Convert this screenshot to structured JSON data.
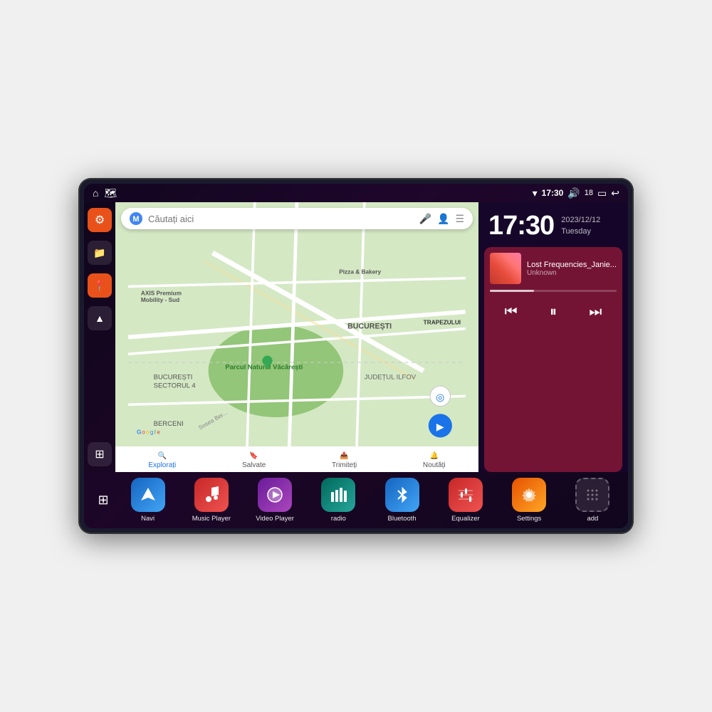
{
  "device": {
    "title": "Car Android Head Unit"
  },
  "statusBar": {
    "wifi_icon": "▾",
    "time": "17:30",
    "volume_icon": "🔊",
    "battery_level": "18",
    "battery_icon": "🔋",
    "back_icon": "↩"
  },
  "sidebar": {
    "icons": [
      {
        "name": "settings",
        "symbol": "⚙",
        "style": "orange"
      },
      {
        "name": "files",
        "symbol": "📁",
        "style": "dark"
      },
      {
        "name": "maps",
        "symbol": "📍",
        "style": "orange"
      },
      {
        "name": "navigation",
        "symbol": "▲",
        "style": "dark"
      }
    ]
  },
  "map": {
    "searchPlaceholder": "Căutați aici",
    "bottomItems": [
      {
        "label": "Explorați",
        "icon": "🔍",
        "active": true
      },
      {
        "label": "Salvate",
        "icon": "🔖",
        "active": false
      },
      {
        "label": "Trimiteți",
        "icon": "📤",
        "active": false
      },
      {
        "label": "Noutăți",
        "icon": "🔔",
        "active": false
      }
    ],
    "labels": [
      "AXIS Premium Mobility - Sud",
      "Pizza & Bakery",
      "Parcul Natural Văcărești",
      "BUCUREȘTI",
      "SECTORUL 4",
      "BUCUREȘTI",
      "JUDEȚUL ILFOV",
      "BERCENI",
      "TRAPEZULUI"
    ]
  },
  "clock": {
    "time": "17:30",
    "date": "2023/12/12",
    "day": "Tuesday"
  },
  "musicPlayer": {
    "songTitle": "Lost Frequencies_Janie...",
    "artist": "Unknown",
    "prevIcon": "⏮",
    "pauseIcon": "⏸",
    "nextIcon": "⏭"
  },
  "apps": [
    {
      "id": "navi",
      "label": "Navi",
      "style": "blue-nav",
      "icon": "▲"
    },
    {
      "id": "music-player",
      "label": "Music Player",
      "style": "red-music",
      "icon": "🎵"
    },
    {
      "id": "video-player",
      "label": "Video Player",
      "style": "purple-video",
      "icon": "▶"
    },
    {
      "id": "radio",
      "label": "radio",
      "style": "teal-radio",
      "icon": "📻"
    },
    {
      "id": "bluetooth",
      "label": "Bluetooth",
      "style": "blue-bt",
      "icon": "⚡"
    },
    {
      "id": "equalizer",
      "label": "Equalizer",
      "style": "red-eq",
      "icon": "🎚"
    },
    {
      "id": "settings",
      "label": "Settings",
      "style": "orange-set",
      "icon": "⚙"
    },
    {
      "id": "add",
      "label": "add",
      "style": "gray-add",
      "icon": "+"
    }
  ],
  "gridToggle": {
    "icon": "⊞"
  }
}
